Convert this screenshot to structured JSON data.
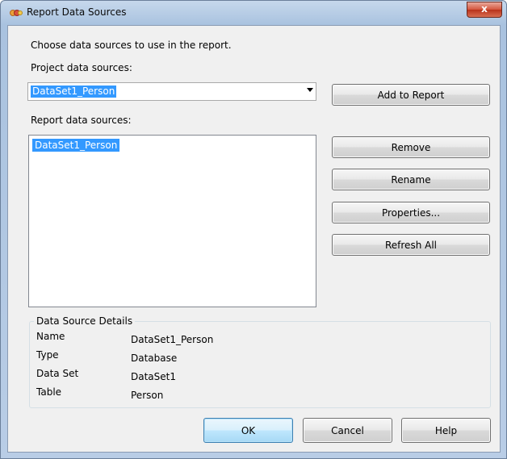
{
  "window": {
    "title": "Report Data Sources",
    "close_glyph": "x",
    "icon": "report-app-icon"
  },
  "intro_text": "Choose data sources to use in the report.",
  "project": {
    "label": "Project data sources:",
    "selected": "DataSet1_Person"
  },
  "report": {
    "label": "Report data sources:",
    "items": [
      "DataSet1_Person"
    ]
  },
  "buttons": {
    "add_to_report": "Add to Report",
    "remove": "Remove",
    "rename": "Rename",
    "properties": "Properties...",
    "refresh_all": "Refresh All",
    "ok": "OK",
    "cancel": "Cancel",
    "help": "Help"
  },
  "details": {
    "title": "Data Source Details",
    "rows": [
      {
        "name": "Name",
        "value": "DataSet1_Person"
      },
      {
        "name": "Type",
        "value": "Database"
      },
      {
        "name": "Data Set",
        "value": "DataSet1"
      },
      {
        "name": "Table",
        "value": "Person"
      }
    ]
  },
  "colors": {
    "selection": "#3399ff",
    "client_background": "#f0f0f0",
    "close_button": "#c7432b"
  }
}
